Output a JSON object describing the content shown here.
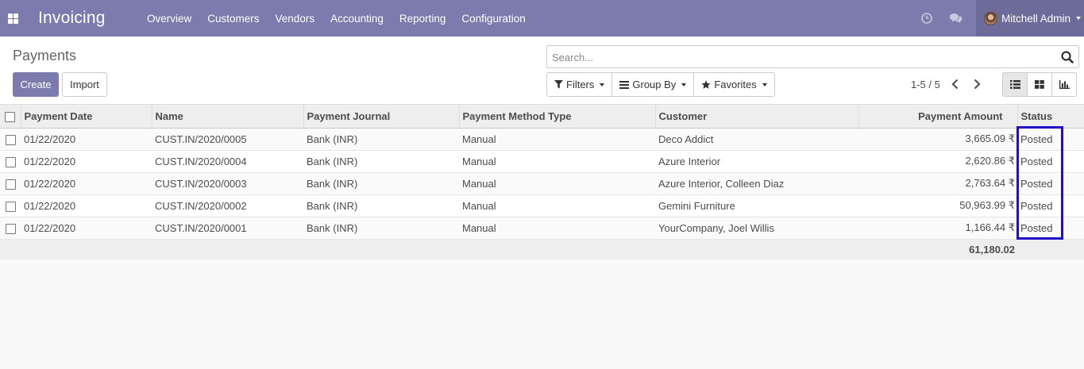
{
  "app": {
    "title": "Invoicing"
  },
  "menu": [
    {
      "label": "Overview"
    },
    {
      "label": "Customers"
    },
    {
      "label": "Vendors"
    },
    {
      "label": "Accounting"
    },
    {
      "label": "Reporting"
    },
    {
      "label": "Configuration"
    }
  ],
  "user": {
    "name": "Mitchell Admin"
  },
  "page": {
    "breadcrumb": "Payments"
  },
  "buttons": {
    "create": "Create",
    "import": "Import"
  },
  "search": {
    "placeholder": "Search..."
  },
  "filters": {
    "filters": "Filters",
    "group_by": "Group By",
    "favorites": "Favorites"
  },
  "pager": {
    "text": "1-5 / 5"
  },
  "table": {
    "columns": [
      "Payment Date",
      "Name",
      "Payment Journal",
      "Payment Method Type",
      "Customer",
      "Payment Amount",
      "Status"
    ],
    "rows": [
      {
        "date": "01/22/2020",
        "name": "CUST.IN/2020/0005",
        "journal": "Bank (INR)",
        "method": "Manual",
        "customer": "Deco Addict",
        "amount": "3,665.09 ₹",
        "status": "Posted"
      },
      {
        "date": "01/22/2020",
        "name": "CUST.IN/2020/0004",
        "journal": "Bank (INR)",
        "method": "Manual",
        "customer": "Azure Interior",
        "amount": "2,620.86 ₹",
        "status": "Posted"
      },
      {
        "date": "01/22/2020",
        "name": "CUST.IN/2020/0003",
        "journal": "Bank (INR)",
        "method": "Manual",
        "customer": "Azure Interior, Colleen Diaz",
        "amount": "2,763.64 ₹",
        "status": "Posted"
      },
      {
        "date": "01/22/2020",
        "name": "CUST.IN/2020/0002",
        "journal": "Bank (INR)",
        "method": "Manual",
        "customer": "Gemini Furniture",
        "amount": "50,963.99 ₹",
        "status": "Posted"
      },
      {
        "date": "01/22/2020",
        "name": "CUST.IN/2020/0001",
        "journal": "Bank (INR)",
        "method": "Manual",
        "customer": "YourCompany, Joel Willis",
        "amount": "1,166.44 ₹",
        "status": "Posted"
      }
    ],
    "total": "61,180.02"
  },
  "colors": {
    "brand": "#7c7bad",
    "highlight": "#1f0fc7"
  },
  "icons": [
    "apps-icon",
    "clock-icon",
    "chat-icon",
    "search-icon",
    "filter-icon",
    "group-by-icon",
    "star-icon",
    "chevron-left-icon",
    "chevron-right-icon",
    "list-view-icon",
    "kanban-view-icon",
    "graph-view-icon"
  ]
}
